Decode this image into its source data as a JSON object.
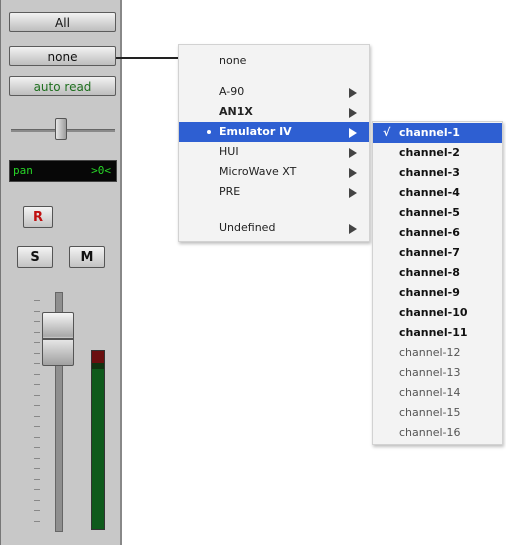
{
  "strip": {
    "buttons": {
      "all": "All",
      "none": "none",
      "auto_read": "auto read"
    },
    "pan_display": {
      "label": "pan",
      "value": ">0<"
    },
    "record": "R",
    "solo": "S",
    "mute": "M"
  },
  "menu": {
    "header": "none",
    "items": [
      {
        "label": "A-90"
      },
      {
        "label": "AN1X"
      },
      {
        "label": "Emulator IV"
      },
      {
        "label": "HUI"
      },
      {
        "label": "MicroWave XT"
      },
      {
        "label": "PRE"
      },
      {
        "label": "Undefined"
      }
    ]
  },
  "submenu": {
    "check": "√",
    "items": [
      "channel-1",
      "channel-2",
      "channel-3",
      "channel-4",
      "channel-5",
      "channel-6",
      "channel-7",
      "channel-8",
      "channel-9",
      "channel-10",
      "channel-11",
      "channel-12",
      "channel-13",
      "channel-14",
      "channel-15",
      "channel-16"
    ]
  },
  "colors": {
    "highlight": "#2e5fd2",
    "meter": "#0f5a1c",
    "pan_text": "#27d427"
  }
}
